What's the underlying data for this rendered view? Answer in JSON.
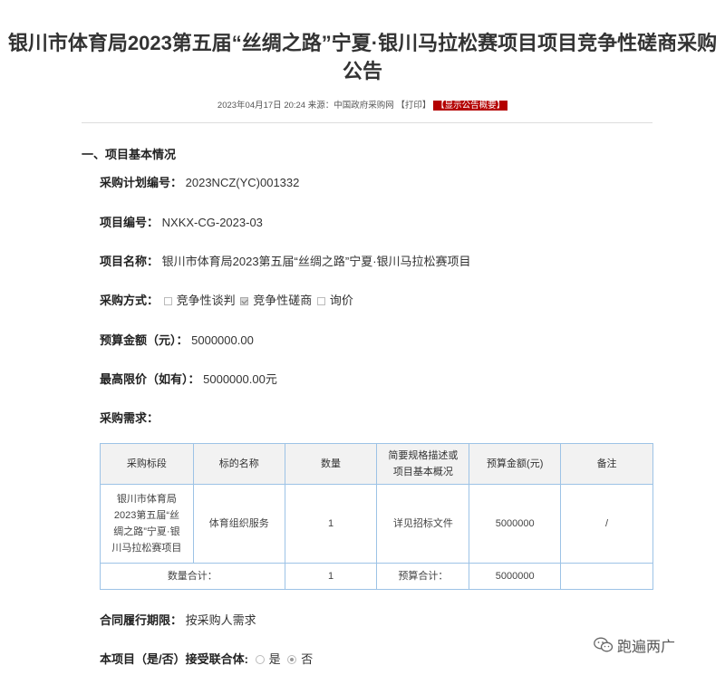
{
  "page": {
    "title_line1": "银川市体育局2023第五届“丝绸之路”宁夏·银川马拉松赛项目项目竞争性磋商采购",
    "title_line2": "公告"
  },
  "meta": {
    "datetime": "2023年04月17日 20:24",
    "source_label": "来源：",
    "source": "中国政府采购网",
    "print": "【打印】",
    "show_summary": "【显示公告概要】"
  },
  "section": {
    "heading": "一、项目基本情况"
  },
  "fields": {
    "plan_no_label": "采购计划编号：",
    "plan_no": "2023NCZ(YC)001332",
    "project_no_label": "项目编号：",
    "project_no": "NXKX-CG-2023-03",
    "project_name_label": "项目名称：",
    "project_name": "银川市体育局2023第五届“丝绸之路”宁夏·银川马拉松赛项目",
    "method_label": "采购方式：",
    "method_options": [
      {
        "label": "竞争性谈判",
        "checked": false
      },
      {
        "label": "竞争性磋商",
        "checked": true
      },
      {
        "label": "询价",
        "checked": false
      }
    ],
    "budget_label": "预算金额（元）：",
    "budget": "5000000.00",
    "max_price_label": "最高限价（如有）：",
    "max_price": "5000000.00元",
    "requirements_label": "采购需求：",
    "contract_period_label": "合同履行期限：",
    "contract_period": "按采购人需求",
    "consortium_label": "本项目（是/否）接受联合体:",
    "consortium_options": [
      {
        "label": "是",
        "selected": false
      },
      {
        "label": "否",
        "selected": true
      }
    ]
  },
  "table": {
    "headers": [
      "采购标段",
      "标的名称",
      "数量",
      "简要规格描述或项目基本概况",
      "预算金额(元)",
      "备注"
    ],
    "header_spec_line1": "简要规格描述或",
    "header_spec_line2": "项目基本概况",
    "row": {
      "lot_lines": [
        "银川市体育局",
        "2023第五届“丝",
        "绸之路”宁夏·银",
        "川马拉松赛项目"
      ],
      "name": "体育组织服务",
      "qty": "1",
      "spec": "详见招标文件",
      "budget": "5000000",
      "note": "/"
    },
    "total": {
      "qty_label": "数量合计：",
      "qty": "1",
      "budget_label": "预算合计：",
      "budget": "5000000",
      "note": ""
    }
  },
  "watermark": {
    "text": "跑遍两广",
    "icon": "wechat-icon"
  }
}
